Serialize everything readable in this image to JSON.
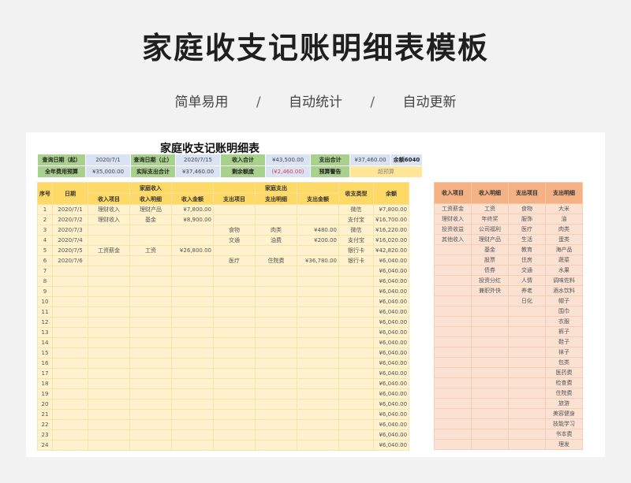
{
  "page": {
    "title": "家庭收支记账明细表模板",
    "features": [
      "简单易用",
      "自动统计",
      "自动更新"
    ],
    "separator": "/"
  },
  "sheet": {
    "title": "家庭收支记账明细表",
    "info": {
      "query_start_label": "查询日期（起）",
      "query_start_value": "2020/7/1",
      "query_end_label": "查询日期（止）",
      "query_end_value": "2020/7/15",
      "income_total_label": "收入合计",
      "income_total_value": "¥43,500.00",
      "expense_total_label": "支出合计",
      "expense_total_value": "¥37,460.00",
      "balance": "余额6040",
      "annual_budget_label": "全年费用预算",
      "annual_budget_value": "¥35,000.00",
      "actual_expense_label": "实际支出合计",
      "actual_expense_value": "¥37,460.00",
      "remaining_label": "剩余额度",
      "remaining_value": "(¥2,460.00)",
      "budget_warning_label": "预算警告",
      "budget_warning_value": "超预算"
    },
    "headers": {
      "index": "序号",
      "date": "日期",
      "income_group": "家庭收入",
      "income_item": "收入项目",
      "income_detail": "收入明细",
      "income_amount": "收入金额",
      "expense_item": "支出项目",
      "expense_group": "家庭支出",
      "expense_detail": "支出明细",
      "expense_amount": "支出金额",
      "payment_type": "收支类型",
      "balance": "余额"
    },
    "rows": [
      [
        "1",
        "2020/7/1",
        "理财收入",
        "理财产品",
        "¥7,800.00",
        "",
        "",
        "",
        "微信",
        "¥7,800.00"
      ],
      [
        "2",
        "2020/7/2",
        "理财收入",
        "基金",
        "¥8,900.00",
        "",
        "",
        "",
        "支付宝",
        "¥16,700.00"
      ],
      [
        "3",
        "2020/7/3",
        "",
        "",
        "",
        "食物",
        "肉类",
        "¥480.00",
        "微信",
        "¥16,220.00"
      ],
      [
        "4",
        "2020/7/4",
        "",
        "",
        "",
        "交通",
        "油费",
        "¥200.00",
        "支付宝",
        "¥16,020.00"
      ],
      [
        "5",
        "2020/7/5",
        "工资薪金",
        "工资",
        "¥26,800.00",
        "",
        "",
        "",
        "银行卡",
        "¥42,820.00"
      ],
      [
        "6",
        "2020/7/6",
        "",
        "",
        "",
        "医疗",
        "住院费",
        "¥36,780.00",
        "银行卡",
        "¥6,040.00"
      ],
      [
        "7",
        "",
        "",
        "",
        "",
        "",
        "",
        "",
        "",
        "¥6,040.00"
      ],
      [
        "8",
        "",
        "",
        "",
        "",
        "",
        "",
        "",
        "",
        "¥6,040.00"
      ],
      [
        "9",
        "",
        "",
        "",
        "",
        "",
        "",
        "",
        "",
        "¥6,040.00"
      ],
      [
        "10",
        "",
        "",
        "",
        "",
        "",
        "",
        "",
        "",
        "¥6,040.00"
      ],
      [
        "11",
        "",
        "",
        "",
        "",
        "",
        "",
        "",
        "",
        "¥6,040.00"
      ],
      [
        "12",
        "",
        "",
        "",
        "",
        "",
        "",
        "",
        "",
        "¥6,040.00"
      ],
      [
        "13",
        "",
        "",
        "",
        "",
        "",
        "",
        "",
        "",
        "¥6,040.00"
      ],
      [
        "14",
        "",
        "",
        "",
        "",
        "",
        "",
        "",
        "",
        "¥6,040.00"
      ],
      [
        "15",
        "",
        "",
        "",
        "",
        "",
        "",
        "",
        "",
        "¥6,040.00"
      ],
      [
        "16",
        "",
        "",
        "",
        "",
        "",
        "",
        "",
        "",
        "¥6,040.00"
      ],
      [
        "17",
        "",
        "",
        "",
        "",
        "",
        "",
        "",
        "",
        "¥6,040.00"
      ],
      [
        "18",
        "",
        "",
        "",
        "",
        "",
        "",
        "",
        "",
        "¥6,040.00"
      ],
      [
        "19",
        "",
        "",
        "",
        "",
        "",
        "",
        "",
        "",
        "¥6,040.00"
      ],
      [
        "20",
        "",
        "",
        "",
        "",
        "",
        "",
        "",
        "",
        "¥6,040.00"
      ],
      [
        "21",
        "",
        "",
        "",
        "",
        "",
        "",
        "",
        "",
        "¥6,040.00"
      ],
      [
        "22",
        "",
        "",
        "",
        "",
        "",
        "",
        "",
        "",
        "¥6,040.00"
      ],
      [
        "23",
        "",
        "",
        "",
        "",
        "",
        "",
        "",
        "",
        "¥6,040.00"
      ],
      [
        "24",
        "",
        "",
        "",
        "",
        "",
        "",
        "",
        "",
        "¥6,040.00"
      ]
    ],
    "category_headers": [
      "收入项目",
      "收入明细",
      "支出项目",
      "支出明细"
    ],
    "category_rows": [
      [
        "工资薪金",
        "工资",
        "食物",
        "大米"
      ],
      [
        "理财收入",
        "年终奖",
        "服饰",
        "油"
      ],
      [
        "投资收益",
        "公司福利",
        "医疗",
        "肉类"
      ],
      [
        "其他收入",
        "理财产品",
        "生活",
        "蛋类"
      ],
      [
        "",
        "基金",
        "教育",
        "海产品"
      ],
      [
        "",
        "股票",
        "住房",
        "蔬菜"
      ],
      [
        "",
        "债券",
        "交通",
        "水果"
      ],
      [
        "",
        "投资分红",
        "人情",
        "调味佐料"
      ],
      [
        "",
        "兼职外快",
        "养老",
        "酒水饮料"
      ],
      [
        "",
        "",
        "日化",
        "帽子"
      ],
      [
        "",
        "",
        "",
        "围巾"
      ],
      [
        "",
        "",
        "",
        "衣服"
      ],
      [
        "",
        "",
        "",
        "裤子"
      ],
      [
        "",
        "",
        "",
        "鞋子"
      ],
      [
        "",
        "",
        "",
        "袜子"
      ],
      [
        "",
        "",
        "",
        "包类"
      ],
      [
        "",
        "",
        "",
        "医药费"
      ],
      [
        "",
        "",
        "",
        "检查费"
      ],
      [
        "",
        "",
        "",
        "住院费"
      ],
      [
        "",
        "",
        "",
        "旅游"
      ],
      [
        "",
        "",
        "",
        "美容健身"
      ],
      [
        "",
        "",
        "",
        "技能学习"
      ],
      [
        "",
        "",
        "",
        "书本费"
      ],
      [
        "",
        "",
        "",
        "理发"
      ]
    ]
  }
}
